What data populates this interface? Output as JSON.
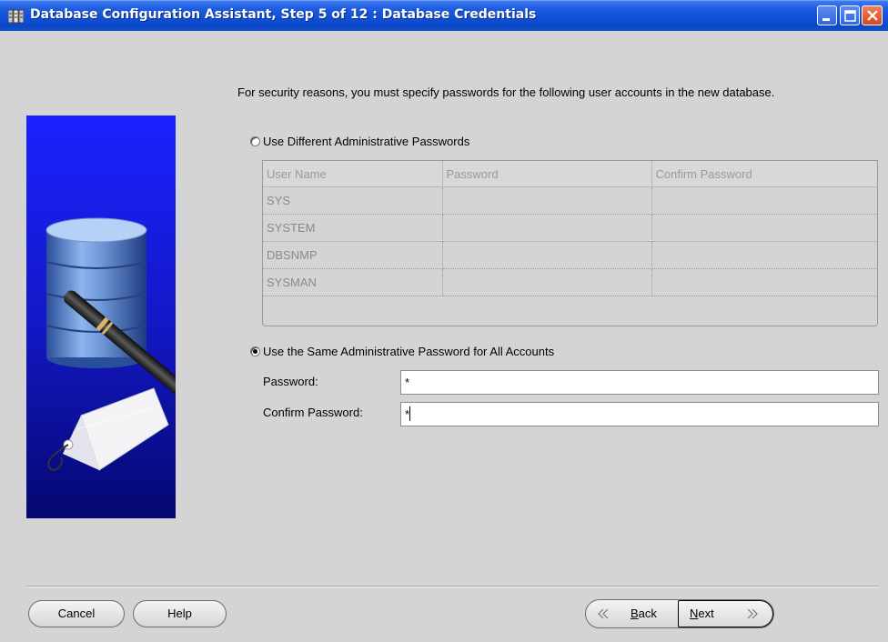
{
  "window": {
    "title": "Database Configuration Assistant, Step 5 of 12 : Database Credentials"
  },
  "intro_text": "For security reasons, you must specify passwords for the following user accounts in the new database.",
  "options": {
    "different_label": "Use Different Administrative Passwords",
    "same_label": "Use the Same Administrative Password for All Accounts",
    "selected": "same"
  },
  "grid": {
    "columns": [
      "User Name",
      "Password",
      "Confirm Password"
    ],
    "rows": [
      [
        "SYS",
        "",
        ""
      ],
      [
        "SYSTEM",
        "",
        ""
      ],
      [
        "DBSNMP",
        "",
        ""
      ],
      [
        "SYSMAN",
        "",
        ""
      ]
    ]
  },
  "fields": {
    "password_label": "Password:",
    "password_value": "*",
    "confirm_label": "Confirm Password:",
    "confirm_value": "*"
  },
  "buttons": {
    "cancel": "Cancel",
    "help": "Help",
    "back_mnemonic": "B",
    "back_rest": "ack",
    "next_mnemonic": "N",
    "next_rest": "ext"
  },
  "icons": [
    "app-icon",
    "minimize-icon",
    "maximize-icon",
    "close-icon",
    "back-arrow-icon",
    "next-arrow-icon",
    "database-illustration"
  ]
}
